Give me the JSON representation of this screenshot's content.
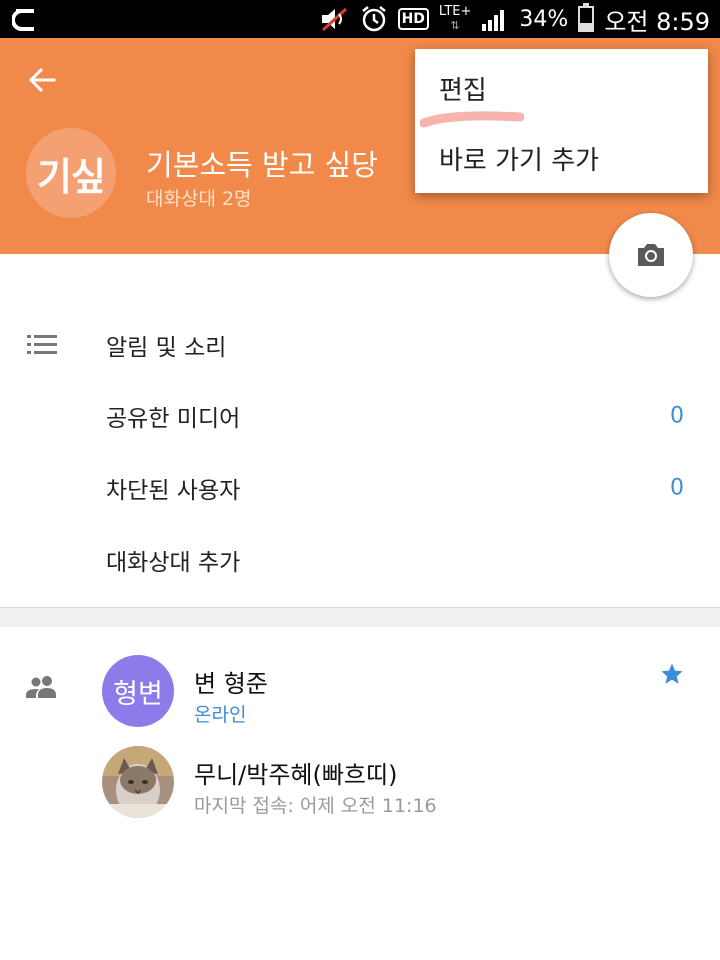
{
  "status_bar": {
    "battery_percent": "34%",
    "battery_level": 0.34,
    "time": "오전 8:59",
    "network": "LTE+",
    "hd_label": "HD",
    "icons": [
      "app-notification-icon",
      "mute-icon",
      "alarm-icon",
      "hd-voice-icon",
      "lte-icon",
      "signal-icon",
      "battery-icon"
    ]
  },
  "header": {
    "back_icon": "arrow-back-icon",
    "avatar_text": "기싶",
    "group_name": "기본소득 받고 싶당",
    "member_count": "대화상대 2명",
    "color": "#f1894a"
  },
  "popup_menu": {
    "items": [
      {
        "label": "편집"
      },
      {
        "label": "바로 가기 추가"
      }
    ]
  },
  "camera_button": {
    "icon": "camera-icon"
  },
  "settings": {
    "icon": "list-icon",
    "items": [
      {
        "label": "알림 및 소리",
        "count": ""
      },
      {
        "label": "공유한 미디어",
        "count": "0"
      },
      {
        "label": "차단된 사용자",
        "count": "0"
      },
      {
        "label": "대화상대 추가",
        "count": ""
      }
    ]
  },
  "members": {
    "icon": "people-icon",
    "list": [
      {
        "avatar_text": "형변",
        "avatar_color": "#8c7be8",
        "name": "변 형준",
        "status": "온라인",
        "status_color": "#3a8ed8",
        "starred": true
      },
      {
        "avatar_text": "",
        "avatar_color": "#b8a898",
        "name": "무니/박주혜(빠흐띠)",
        "status": "마지막 접속: 어제 오전 11:16",
        "status_color": "#9a9a9a",
        "starred": false
      }
    ]
  },
  "colors": {
    "accent_blue": "#3a8ed8",
    "header_orange": "#f1894a"
  }
}
